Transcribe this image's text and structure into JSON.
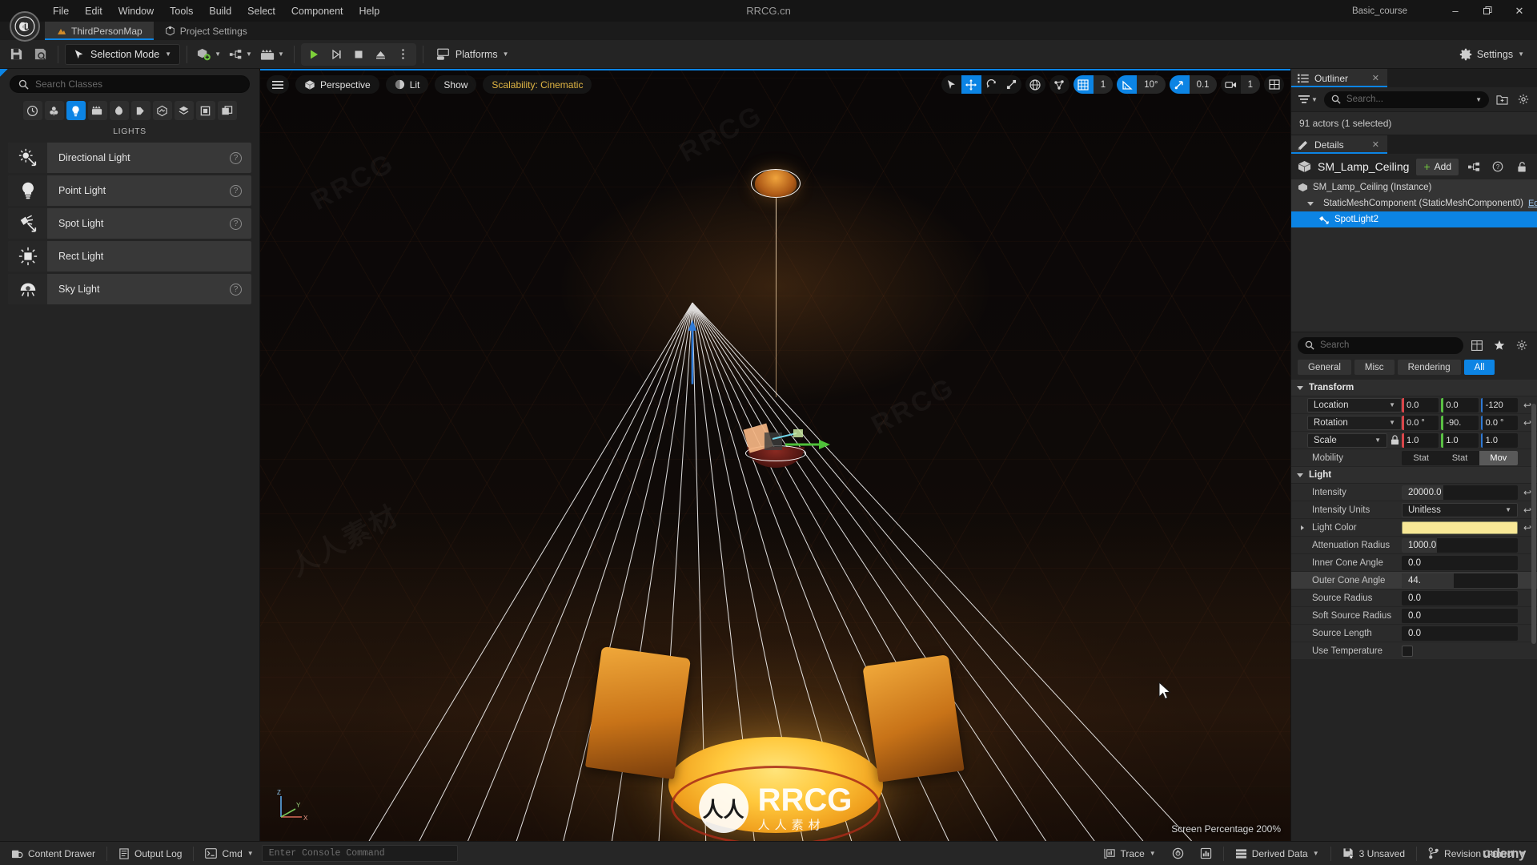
{
  "window": {
    "title": "RRCG.cn",
    "project_label": "Basic_course",
    "buttons": {
      "minimize": "–",
      "maximize": "❐",
      "close": "✕"
    }
  },
  "menubar": {
    "items": [
      "File",
      "Edit",
      "Window",
      "Tools",
      "Build",
      "Select",
      "Component",
      "Help"
    ]
  },
  "tabs": [
    {
      "label": "ThirdPersonMap",
      "icon": "level-icon",
      "active": true
    },
    {
      "label": "Project Settings",
      "icon": "settings-cube-icon",
      "active": false
    }
  ],
  "toolbar": {
    "save_icon": "save-icon",
    "browse_icon": "browse-icon",
    "selection_mode": "Selection Mode",
    "quick_add_icon": "quick-add-actor-icon",
    "blueprints_icon": "blueprints-icon",
    "cinematics_icon": "cinematics-icon",
    "play_icon": "play-icon",
    "skip_icon": "skip-play-icon",
    "stop_icon": "stop-icon",
    "eject_icon": "eject-icon",
    "more_icon": "more-options-icon",
    "platforms": "Platforms",
    "settings": "Settings"
  },
  "left_panel": {
    "search_placeholder": "Search Classes",
    "search_value": "",
    "category_icons": [
      {
        "name": "recently-placed-icon",
        "active": false
      },
      {
        "name": "basic-icon",
        "active": false
      },
      {
        "name": "lights-icon",
        "active": true
      },
      {
        "name": "cinematic-icon",
        "active": false
      },
      {
        "name": "visual-effects-icon",
        "active": false
      },
      {
        "name": "geometry-icon",
        "active": false
      },
      {
        "name": "volumes-icon",
        "active": false
      },
      {
        "name": "all-classes-icon",
        "active": false
      },
      {
        "name": "shapes-icon",
        "active": false
      },
      {
        "name": "more-icon",
        "active": false
      }
    ],
    "section_label": "LIGHTS",
    "lights": [
      {
        "label": "Directional Light",
        "icon": "directional-light-icon",
        "help": true
      },
      {
        "label": "Point Light",
        "icon": "point-light-icon",
        "help": true
      },
      {
        "label": "Spot Light",
        "icon": "spot-light-icon",
        "help": true
      },
      {
        "label": "Rect Light",
        "icon": "rect-light-icon",
        "help": false
      },
      {
        "label": "Sky Light",
        "icon": "sky-light-icon",
        "help": true
      }
    ]
  },
  "viewport": {
    "menu_icon": "viewport-menu-icon",
    "perspective": "Perspective",
    "view_mode": "Lit",
    "show": "Show",
    "scalability": "Scalability: Cinematic",
    "gizmos": [
      {
        "name": "select-tool-icon",
        "active": false
      },
      {
        "name": "translate-tool-icon",
        "active": true
      },
      {
        "name": "rotate-tool-icon",
        "active": false
      },
      {
        "name": "scale-tool-icon",
        "active": false
      }
    ],
    "world_icon": "world-coordinates-icon",
    "surface_snap_icon": "surface-snap-icon",
    "grid_snap": {
      "icon": "grid-snap-icon",
      "value": "1",
      "active": true
    },
    "angle_snap": {
      "icon": "angle-snap-icon",
      "value": "10°",
      "active": true
    },
    "scale_snap": {
      "icon": "scale-snap-icon",
      "value": "0.1",
      "active": true
    },
    "camera_speed": {
      "icon": "camera-speed-icon",
      "value": "1",
      "active": false
    },
    "maximize_icon": "viewport-layout-icon",
    "screen_percentage": "Screen Percentage  200%",
    "axis_labels": {
      "z": "Z",
      "y": "Y",
      "x": "X"
    }
  },
  "outliner": {
    "tab_label": "Outliner",
    "close_icon": "close-icon",
    "filter_icon": "filter-icon",
    "search_placeholder": "Search...",
    "search_value": "",
    "add_folder_icon": "add-folder-icon",
    "settings_icon": "gear-icon",
    "status": "91 actors (1 selected)"
  },
  "details": {
    "tab_label": "Details",
    "close_icon": "close-icon",
    "actor_name": "SM_Lamp_Ceiling",
    "actor_icon": "static-mesh-icon",
    "add_label": "Add",
    "graph_icon": "blueprint-graph-icon",
    "help_icon": "help-icon",
    "lock_icon": "unlock-icon",
    "component_tree": [
      {
        "label": "SM_Lamp_Ceiling (Instance)",
        "icon": "static-mesh-icon",
        "level": 1,
        "selected": false,
        "edit": ""
      },
      {
        "label": "StaticMeshComponent (StaticMeshComponent0)",
        "icon": "static-mesh-icon",
        "level": 2,
        "selected": false,
        "edit": "Edi"
      },
      {
        "label": "SpotLight2",
        "icon": "spot-light-icon",
        "level": 3,
        "selected": true,
        "edit": ""
      }
    ],
    "search_placeholder": "Search",
    "search_value": "",
    "table_icon": "table-view-icon",
    "favorite_icon": "star-icon",
    "gear_icon": "gear-icon",
    "filter_tabs": [
      {
        "label": "General",
        "active": false
      },
      {
        "label": "Misc",
        "active": false
      },
      {
        "label": "Rendering",
        "active": false
      },
      {
        "label": "All",
        "active": true
      }
    ],
    "sections": [
      {
        "title": "Transform",
        "rows": [
          {
            "label": "Location",
            "type": "vector-combo",
            "values": [
              "0.0",
              "0.0",
              "-120"
            ],
            "reset": true
          },
          {
            "label": "Rotation",
            "type": "vector-combo",
            "values": [
              "0.0 °",
              "-90.",
              "0.0 °"
            ],
            "reset": true
          },
          {
            "label": "Scale",
            "type": "vector-combo-lock",
            "values": [
              "1.0",
              "1.0",
              "1.0"
            ],
            "reset": false,
            "lock_icon": "lock-icon"
          },
          {
            "label": "Mobility",
            "type": "mobility",
            "options": [
              "Stat",
              "Stat",
              "Mov"
            ],
            "selected_index": 2
          }
        ]
      },
      {
        "title": "Light",
        "rows": [
          {
            "label": "Intensity",
            "type": "number",
            "value": "20000.0",
            "fill_pct": 36,
            "reset": true
          },
          {
            "label": "Intensity Units",
            "type": "dropdown",
            "value": "Unitless",
            "reset": true
          },
          {
            "label": "Light Color",
            "type": "color",
            "value": "#f8e896",
            "expandable": true,
            "reset": true
          },
          {
            "label": "Attenuation Radius",
            "type": "number",
            "value": "1000.0",
            "fill_pct": 30,
            "reset": false
          },
          {
            "label": "Inner Cone Angle",
            "type": "number",
            "value": "0.0",
            "fill_pct": 0,
            "reset": false
          },
          {
            "label": "Outer Cone Angle",
            "type": "number",
            "value": "44.",
            "fill_pct": 45,
            "reset": false,
            "highlight": true
          },
          {
            "label": "Source Radius",
            "type": "number",
            "value": "0.0",
            "fill_pct": 0,
            "reset": false
          },
          {
            "label": "Soft Source Radius",
            "type": "number",
            "value": "0.0",
            "fill_pct": 0,
            "reset": false
          },
          {
            "label": "Source Length",
            "type": "number",
            "value": "0.0",
            "fill_pct": 0,
            "reset": false
          },
          {
            "label": "Use Temperature",
            "type": "checkbox",
            "checked": false,
            "reset": false
          }
        ]
      }
    ]
  },
  "statusbar": {
    "content_drawer": "Content Drawer",
    "content_drawer_icon": "drawer-icon",
    "output_log": "Output Log",
    "output_log_icon": "log-icon",
    "cmd": "Cmd",
    "cmd_icon": "console-icon",
    "console_placeholder": "Enter Console Command",
    "console_value": "",
    "trace": "Trace",
    "trace_icon": "trace-icon",
    "perf1_icon": "performance-icon",
    "perf2_icon": "stats-icon",
    "derived_data": "Derived Data",
    "derived_data_icon": "database-icon",
    "unsaved": "3 Unsaved",
    "unsaved_icon": "save-star-icon",
    "revision_control": "Revision Control",
    "revision_icon": "branch-icon",
    "udemy": "ưdemy"
  },
  "watermark": {
    "brand": "RRCG",
    "sub": "人人素材",
    "logo": "人人"
  }
}
